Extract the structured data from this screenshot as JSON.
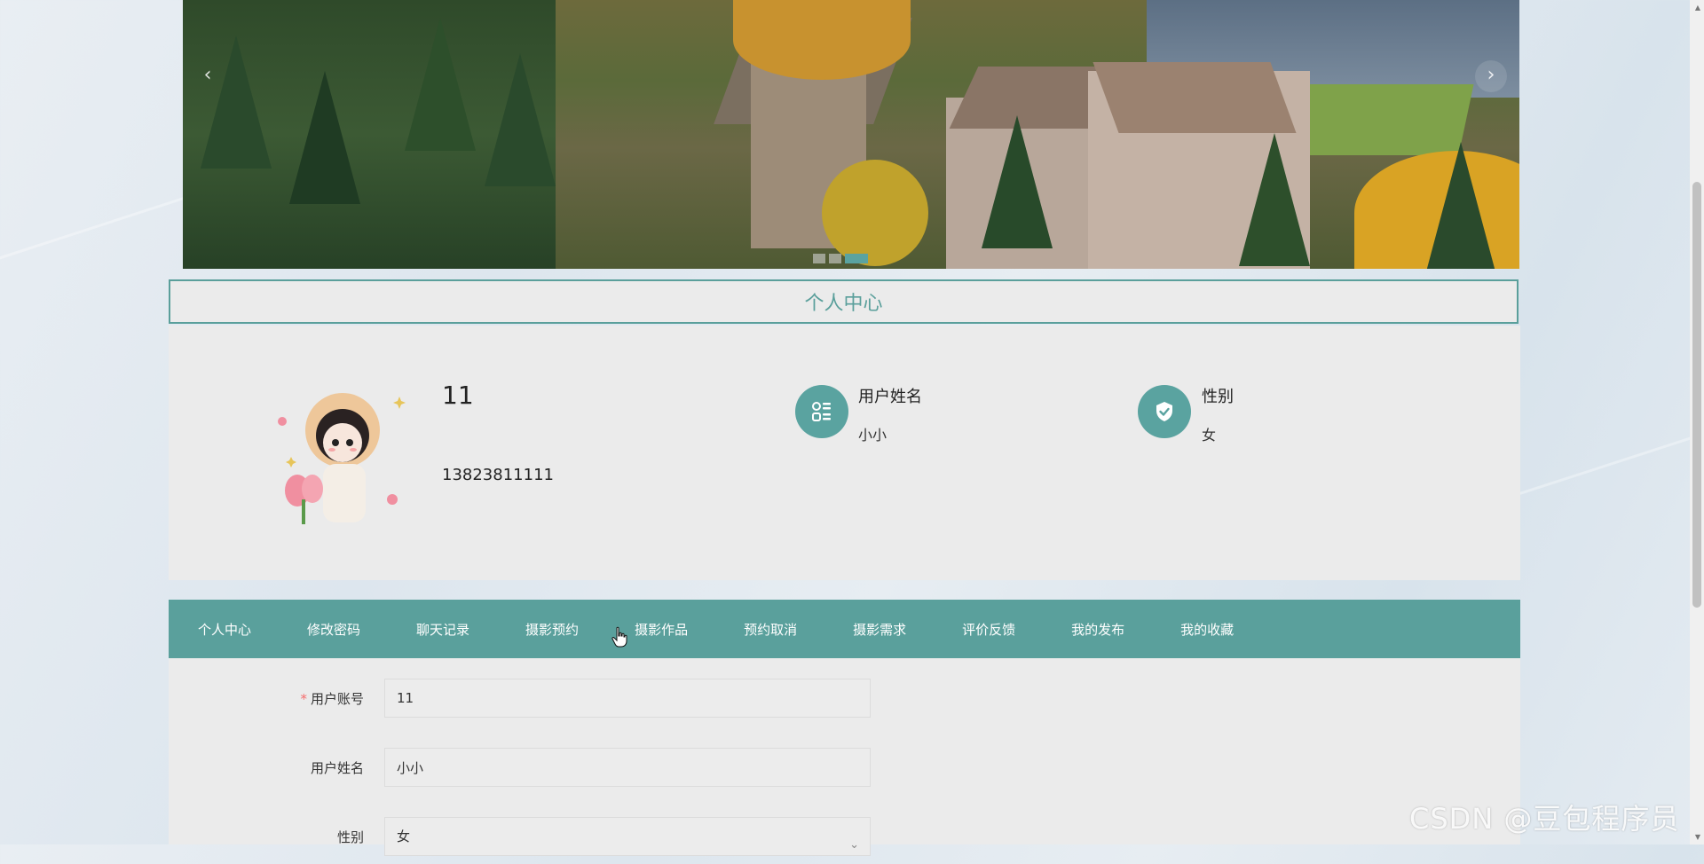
{
  "banner": {
    "prev_arrow": "‹",
    "next_arrow": "›",
    "active_slide": 3,
    "slide_count": 3
  },
  "section_title": "个人中心",
  "profile": {
    "account": "11",
    "phone": "13823811111",
    "name_label": "用户姓名",
    "name_value": "小小",
    "gender_label": "性别",
    "gender_value": "女"
  },
  "tabs": [
    "个人中心",
    "修改密码",
    "聊天记录",
    "摄影预约",
    "摄影作品",
    "预约取消",
    "摄影需求",
    "评价反馈",
    "我的发布",
    "我的收藏"
  ],
  "form": {
    "account_label": "用户账号",
    "account_required": "*",
    "account_value": "11",
    "name_label": "用户姓名",
    "name_value": "小小",
    "gender_label": "性别",
    "gender_value": "女"
  },
  "watermark": "CSDN @豆包程序员",
  "colors": {
    "accent": "#5aa09c",
    "panel": "#ebebeb",
    "required": "#f56c6c"
  }
}
